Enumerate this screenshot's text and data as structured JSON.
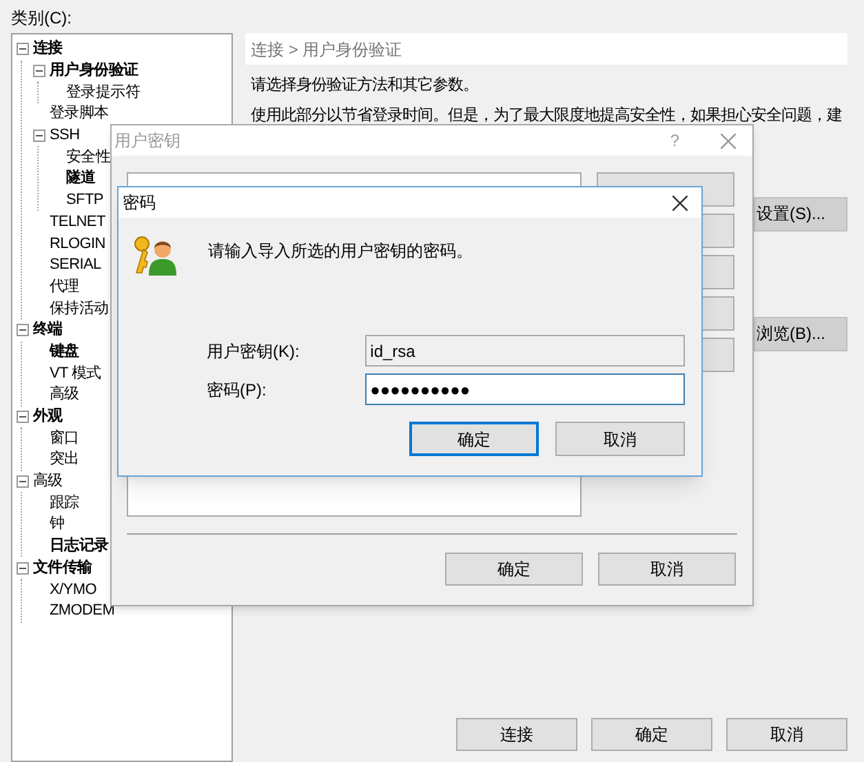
{
  "main": {
    "category_label": "类别(C):",
    "tree": [
      {
        "label": "连接",
        "bold": true,
        "expanded": true,
        "children": [
          {
            "label": "用户身份验证",
            "bold": true,
            "expanded": true,
            "children": [
              {
                "label": "登录提示符",
                "bold": false
              }
            ]
          },
          {
            "label": "登录脚本",
            "bold": false
          },
          {
            "label": "SSH",
            "bold": false,
            "expanded": true,
            "children": [
              {
                "label": "安全性",
                "bold": false
              },
              {
                "label": "隧道",
                "bold": true
              },
              {
                "label": "SFTP",
                "bold": false
              }
            ]
          },
          {
            "label": "TELNET",
            "bold": false
          },
          {
            "label": "RLOGIN",
            "bold": false
          },
          {
            "label": "SERIAL",
            "bold": false
          },
          {
            "label": "代理",
            "bold": false
          },
          {
            "label": "保持活动",
            "bold": false
          }
        ]
      },
      {
        "label": "终端",
        "bold": true,
        "expanded": true,
        "children": [
          {
            "label": "键盘",
            "bold": true
          },
          {
            "label": "VT 模式",
            "bold": false
          },
          {
            "label": "高级",
            "bold": false
          }
        ]
      },
      {
        "label": "外观",
        "bold": true,
        "expanded": true,
        "children": [
          {
            "label": "窗口",
            "bold": false
          },
          {
            "label": "突出",
            "bold": false
          }
        ]
      },
      {
        "label": "高级",
        "bold": false,
        "expanded": true,
        "children": [
          {
            "label": "跟踪",
            "bold": false
          },
          {
            "label": "钟",
            "bold": false
          },
          {
            "label": "日志记录",
            "bold": true
          }
        ]
      },
      {
        "label": "文件传输",
        "bold": true,
        "expanded": true,
        "children": [
          {
            "label": "X/YMO",
            "bold": false
          },
          {
            "label": "ZMODEM",
            "bold": false
          }
        ]
      }
    ],
    "breadcrumb": "连接 > 用户身份验证",
    "description": [
      "请选择身份验证方法和其它参数。",
      "使用此部分以节省登录时间。但是，为了最大限度地提高安全性，如果担心安全问题，建"
    ],
    "side_buttons": [
      "设置(S)...",
      "浏览(B)..."
    ],
    "buttons": [
      "连接",
      "确定",
      "取消"
    ]
  },
  "user_key_dialog": {
    "title": "用户密钥",
    "help_label": "?",
    "buttons": [
      "确定",
      "取消"
    ]
  },
  "password_dialog": {
    "title": "密码",
    "message": "请输入导入所选的用户密钥的密码。",
    "fields": [
      {
        "label": "用户密钥(K):",
        "value": "id_rsa",
        "disabled": true,
        "focused": false
      },
      {
        "label": "密码(P):",
        "value": "●●●●●●●●●●",
        "disabled": false,
        "focused": true
      }
    ],
    "buttons": [
      {
        "label": "确定",
        "default": true
      },
      {
        "label": "取消",
        "default": false
      }
    ]
  }
}
